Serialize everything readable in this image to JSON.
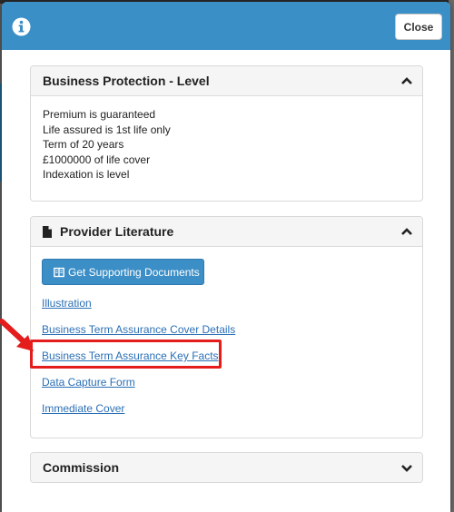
{
  "modal": {
    "close_label": "Close",
    "accent_color": "#3a8fc7"
  },
  "business_protection": {
    "title": "Business Protection - Level",
    "lines": [
      "Premium is guaranteed",
      "Life assured is 1st life only",
      "Term of 20 years",
      "£1000000 of life cover",
      "Indexation is level"
    ]
  },
  "provider_literature": {
    "title": "Provider Literature",
    "button_label": "Get Supporting Documents",
    "links": [
      "Illustration",
      "Business Term Assurance Cover Details",
      "Business Term Assurance Key Facts",
      "Data Capture Form",
      "Immediate Cover"
    ],
    "highlighted_link": "Business Term Assurance Key Facts",
    "highlight_color": "#e41c1c"
  },
  "commission": {
    "title": "Commission"
  },
  "icons": {
    "header": "info-icon",
    "collapse": "chevron-up-icon",
    "expand": "chevron-down-icon",
    "document": "document-icon",
    "button": "book-icon"
  }
}
